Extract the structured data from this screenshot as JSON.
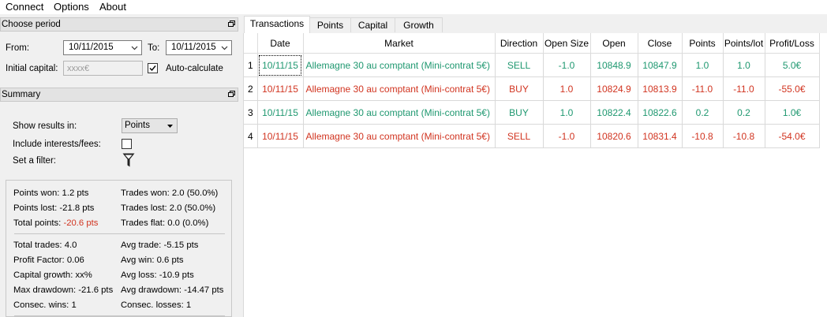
{
  "menubar": {
    "items": [
      "Connect",
      "Options",
      "About"
    ]
  },
  "period": {
    "title": "Choose period",
    "from_label": "From:",
    "from_value": "10/11/2015",
    "to_label": "To:",
    "to_value": "10/11/2015",
    "capital_label": "Initial capital:",
    "capital_placeholder": "xxxx€",
    "autocalc_label": "Auto-calculate",
    "autocalc_checked": true
  },
  "summary": {
    "title": "Summary",
    "show_results_label": "Show results in:",
    "show_results_value": "Points",
    "include_fees_label": "Include interests/fees:",
    "include_fees_checked": false,
    "filter_label": "Set a filter:",
    "stats": {
      "points_won_label": "Points won:",
      "points_won": "1.2 pts",
      "trades_won_label": "Trades won:",
      "trades_won": "2.0 (50.0%)",
      "points_lost_label": "Points lost:",
      "points_lost": "-21.8 pts",
      "trades_lost_label": "Trades lost:",
      "trades_lost": "2.0 (50.0%)",
      "total_points_label": "Total points:",
      "total_points": "-20.6 pts",
      "trades_flat_label": "Trades flat:",
      "trades_flat": "0.0 (0.0%)",
      "total_trades_label": "Total trades:",
      "total_trades": "4.0",
      "avg_trade_label": "Avg trade:",
      "avg_trade": "-5.15 pts",
      "profit_factor_label": "Profit Factor:",
      "profit_factor": "0.06",
      "avg_win_label": "Avg win:",
      "avg_win": "0.6 pts",
      "capital_growth_label": "Capital growth:",
      "capital_growth": "xx%",
      "avg_loss_label": "Avg loss:",
      "avg_loss": "-10.9 pts",
      "max_drawdown_label": "Max drawdown:",
      "max_drawdown": "-21.6 pts",
      "avg_drawdown_label": "Avg drawdown:",
      "avg_drawdown": "-14.47 pts",
      "consec_wins_label": "Consec. wins:",
      "consec_wins": "1",
      "consec_losses_label": "Consec. losses:",
      "consec_losses": "1"
    }
  },
  "tabs": [
    "Transactions",
    "Points",
    "Capital",
    "Growth"
  ],
  "table": {
    "columns": [
      "Date",
      "Market",
      "Direction",
      "Open Size",
      "Open",
      "Close",
      "Points",
      "Points/lot",
      "Profit/Loss"
    ],
    "rows": [
      {
        "n": "1",
        "date": "10/11/15",
        "market": "Allemagne 30 au comptant (Mini-contrat 5€)",
        "direction": "SELL",
        "open_size": "-1.0",
        "open": "10848.9",
        "close": "10847.9",
        "points": "1.0",
        "points_lot": "1.0",
        "pl": "5.0€",
        "status": "win"
      },
      {
        "n": "2",
        "date": "10/11/15",
        "market": "Allemagne 30 au comptant (Mini-contrat 5€)",
        "direction": "BUY",
        "open_size": "1.0",
        "open": "10824.9",
        "close": "10813.9",
        "points": "-11.0",
        "points_lot": "-11.0",
        "pl": "-55.0€",
        "status": "loss"
      },
      {
        "n": "3",
        "date": "10/11/15",
        "market": "Allemagne 30 au comptant (Mini-contrat 5€)",
        "direction": "BUY",
        "open_size": "1.0",
        "open": "10822.4",
        "close": "10822.6",
        "points": "0.2",
        "points_lot": "0.2",
        "pl": "1.0€",
        "status": "win"
      },
      {
        "n": "4",
        "date": "10/11/15",
        "market": "Allemagne 30 au comptant (Mini-contrat 5€)",
        "direction": "SELL",
        "open_size": "-1.0",
        "open": "10820.6",
        "close": "10831.4",
        "points": "-10.8",
        "points_lot": "-10.8",
        "pl": "-54.0€",
        "status": "loss"
      }
    ]
  },
  "colors": {
    "win": "#1f9870",
    "loss": "#d13420"
  }
}
